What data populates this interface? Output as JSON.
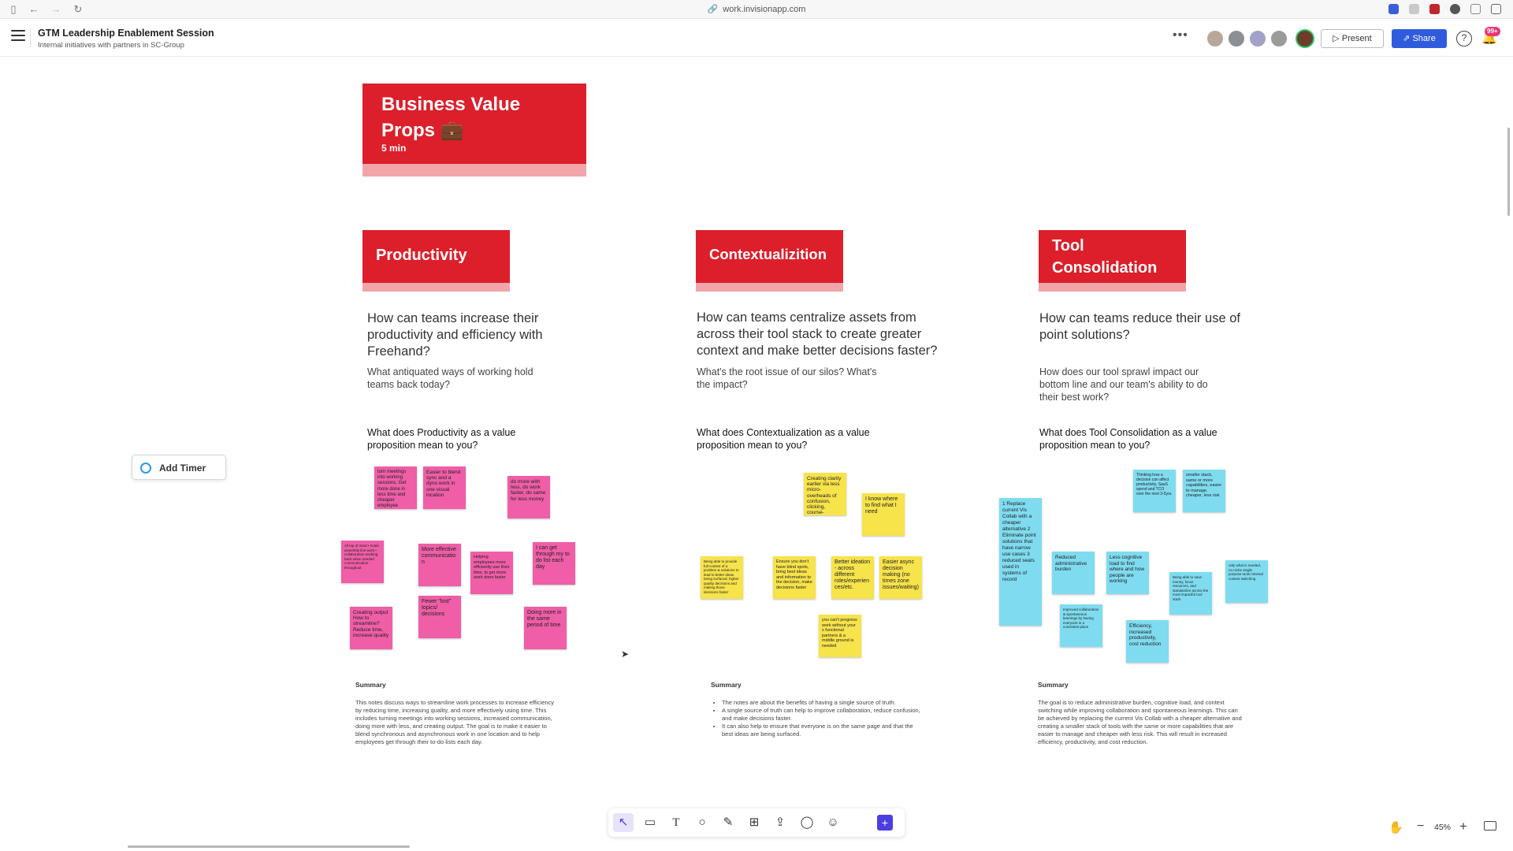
{
  "browser": {
    "url": "work.invisionapp.com"
  },
  "header": {
    "title": "GTM Leadership Enablement Session",
    "subtitle": "Internal initiatives with partners in SC-Group",
    "present_label": "Present",
    "share_label": "Share",
    "help_label": "?",
    "notification_badge": "99+"
  },
  "hero": {
    "title": "Business Value Props 💼",
    "subtitle": "5 min"
  },
  "add_timer_label": "Add Timer",
  "sections": [
    {
      "title": "Productivity",
      "question": "How can teams increase their productivity and efficiency with Freehand?",
      "sub_question": "What antiquated ways of working hold teams back today?",
      "value_prompt": "What does Productivity as a value proposition mean to you?",
      "stickies": [
        "turn meetings into working sessions. Get more done in less time and cheaper employee engagement",
        "Easier to blend sync and a dyno work in one visual location",
        "do more with less, do work faster, do same for less money",
        "All top of mind • Scale assembly line work • collaboration working back when needed communication throughout",
        "More effective communicatio n",
        "Helping employees more efficiently use their time, to get more work done faster",
        "I can get through my to do list each day",
        "Creating output How to streamline? Reduce time, increase quality",
        "Fewer \"lost\" topics/ decisions",
        "Doing more in the same period of time"
      ],
      "summary_title": "Summary",
      "summary_text": "This notes discuss ways to streamline work processes to increase efficiency by reducing time, increasing quality, and more effectively using time. This includes turning meetings into working sessions, increased communication, doing more with less, and creating output. The goal is to make it easier to blend synchronous and asynchronous work in one location and to help employees get through their to-do lists each day."
    },
    {
      "title": "Contextualizition",
      "question": "How can teams centralize assets from across their tool stack to create greater context and make better decisions faster?",
      "sub_question": "What's the root issue of our silos? What's the impact?",
      "value_prompt": "What does Contextualization as a value proposition mean to you?",
      "stickies": [
        "Creating clarity earlier via less micro-overheads of confusion, clicking, course-correcting.",
        "I know where to find what I need",
        "Being able to provide full context of a problem & solutions to lead to better ideas being surfaced, higher quality decisions and making those decisions faster",
        "Ensure you don't have blind spots, bring best ideas and information to the decision, make decisions faster",
        "Better ideation - across different roles/experien ces/etc.",
        "Easier async decision making (no times zone issues/waiting)",
        "you can't progress work without your x functional partners & a middle ground is needed"
      ],
      "summary_title": "Summary",
      "summary_points": [
        "The notes are about the benefits of having a single source of truth.",
        "A single source of truth can help to improve collaboration, reduce confusion, and make decisions faster.",
        "It can also help to ensure that everyone is on the same page and that the best ideas are being surfaced."
      ]
    },
    {
      "title": "Tool Consolidation",
      "question": "How can teams reduce their use of point solutions?",
      "sub_question": "How does our tool sprawl impact our bottom line and our team's ability to do their best work?",
      "value_prompt": "What does Tool Consolidation as a value proposition mean to you?",
      "stickies": [
        "1 Replace current Vis Collab with a cheaper alternative 2 Eliminate point solutions that have narrow use cases 3 reduced seats used in systems of record",
        "Thinking how a decision can affect productivity, SaaS spend and TCO over the next 3-5yrs.",
        "smaller stack, same or more capabilities, easier to manage, cheaper, less risk",
        "Reduced administrative burden",
        "Less cognitive load to find where and how people are working",
        "Being able to save money, focus resources, and standardize across the most impactful tool stack",
        "only what is needed, no niche single purpose tools minimal context switching",
        "Improved collaboration & spontaneous learnings by having everyone in a consistent place",
        "Efficiency, increased productivity, cost reduction"
      ],
      "summary_title": "Summary",
      "summary_text": "The goal is to reduce administrative burden, cognitive load, and context switching while improving collaboration and spontaneous learnings. This can be achieved by replacing the current Vis Collab with a cheaper alternative and creating a smaller stack of tools with the same or more capabilities that are easier to manage and cheaper with less risk. This will result in increased efficiency, productivity, and cost reduction."
    }
  ],
  "toolbar": {
    "tools": [
      "select-tool",
      "sticky-tool",
      "text-tool",
      "shape-tool",
      "pen-tool",
      "table-tool",
      "upload-tool",
      "comment-tool",
      "sticker-tool",
      "more-tool"
    ]
  },
  "zoom": {
    "level": "45%"
  },
  "colors": {
    "red": "#dc1f2b",
    "pink": "#ef5ea7",
    "yellow": "#f7e34a",
    "cyan": "#7fdcf0",
    "share_blue": "#2f5bdc"
  }
}
